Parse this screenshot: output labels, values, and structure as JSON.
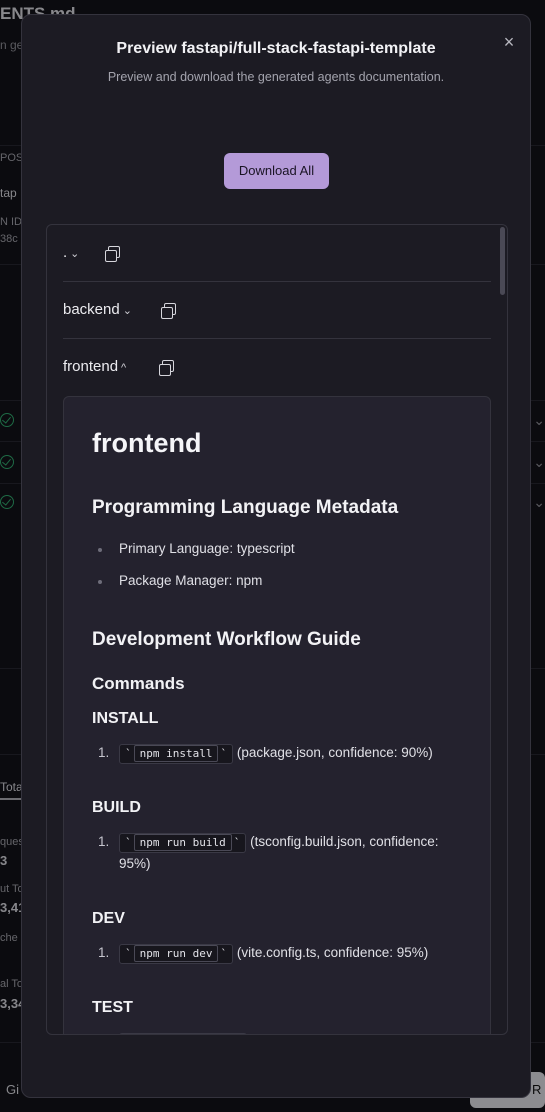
{
  "background": {
    "title_fragment": "ENTS.md",
    "subtitle_fragment": "n ge",
    "snips": [
      "POS",
      "tap",
      "N ID",
      "38c"
    ],
    "tab_fragment": "Tota",
    "stats": [
      {
        "label": "ques",
        "value": "3"
      },
      {
        "label": "ut To",
        "value": "3,41"
      },
      {
        "label": "che",
        "value": ""
      },
      {
        "label": "al To",
        "value": "3,34"
      }
    ],
    "left_button_fragment": "Gi",
    "right_button_fragment": "R"
  },
  "modal": {
    "title": "Preview fastapi/full-stack-fastapi-template",
    "description": "Preview and download the generated agents documentation.",
    "close_label": "×",
    "download_all_label": "Download All",
    "sections": [
      {
        "name": ".",
        "expanded": false
      },
      {
        "name": "backend",
        "expanded": false
      },
      {
        "name": "frontend",
        "expanded": true
      }
    ],
    "chevron_down": "⌄",
    "chevron_up": "^"
  },
  "document": {
    "title": "frontend",
    "metadata_heading": "Programming Language Metadata",
    "metadata_items": [
      "Primary Language: typescript",
      "Package Manager: npm"
    ],
    "workflow_heading": "Development Workflow Guide",
    "commands_heading": "Commands",
    "groups": [
      {
        "name": "INSTALL",
        "num": "1.",
        "command": "npm install",
        "detail": "(package.json, confidence: 90%)"
      },
      {
        "name": "BUILD",
        "num": "1.",
        "command": "npm run build",
        "detail": "(tsconfig.build.json, confidence: 95%)"
      },
      {
        "name": "DEV",
        "num": "1.",
        "command": "npm run dev",
        "detail": "(vite.config.ts, confidence: 95%)"
      },
      {
        "name": "TEST",
        "num": "",
        "command": "",
        "detail": ""
      }
    ],
    "backtick": "`"
  }
}
